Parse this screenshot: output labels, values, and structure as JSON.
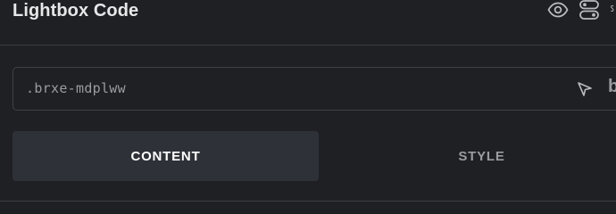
{
  "header": {
    "title": "Lightbox Code",
    "icons": [
      "eye-icon",
      "toggle-icon",
      "more-icon"
    ]
  },
  "selector": {
    "value": ".brxe-mdplww",
    "icons": [
      "cursor-icon",
      "b-icon"
    ],
    "b_label": "b"
  },
  "tabs": [
    {
      "label": "CONTENT",
      "active": true
    },
    {
      "label": "STYLE",
      "active": false
    }
  ],
  "colors": {
    "background": "#1e2023",
    "active_tab": "#2e3238",
    "text_primary": "#ffffff",
    "text_muted": "#9a9ca0",
    "border": "#3a3d42"
  }
}
